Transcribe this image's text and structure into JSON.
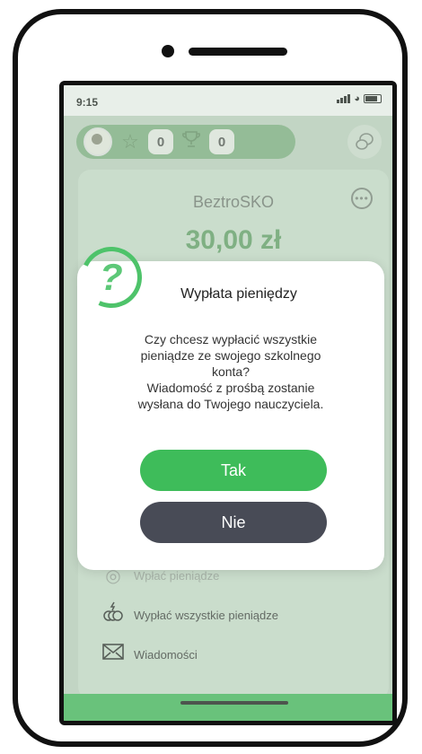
{
  "status_bar": {
    "time": "9:15"
  },
  "header": {
    "stars_count": "0",
    "trophies_count": "0"
  },
  "account": {
    "name": "BeztroSKO",
    "balance": "30,00 zł"
  },
  "menu": {
    "items": [
      {
        "label": "Wpłać pieniądze"
      },
      {
        "label": "Wypłać wszystkie pieniądze"
      },
      {
        "label": "Wiadomości"
      }
    ]
  },
  "dialog": {
    "icon": "?",
    "title": "Wypłata pieniędzy",
    "body": "Czy chcesz wypłacić wszystkie\npieniądze ze swojego szkolnego\nkonta?\nWiadomość z prośbą zostanie\nwysłana do Twojego nauczyciela.",
    "yes_label": "Tak",
    "no_label": "Nie"
  },
  "colors": {
    "accent_green": "#3ebc5a",
    "dark_button": "#484b56",
    "balance_green": "#5e9e63"
  },
  "icons": {
    "star": "star-icon",
    "trophy": "trophy-icon",
    "chat": "chat-bubbles-icon",
    "more": "more-dots-icon",
    "deposit": "coins-icon",
    "withdraw": "coins-withdraw-icon",
    "messages": "envelope-icon"
  }
}
